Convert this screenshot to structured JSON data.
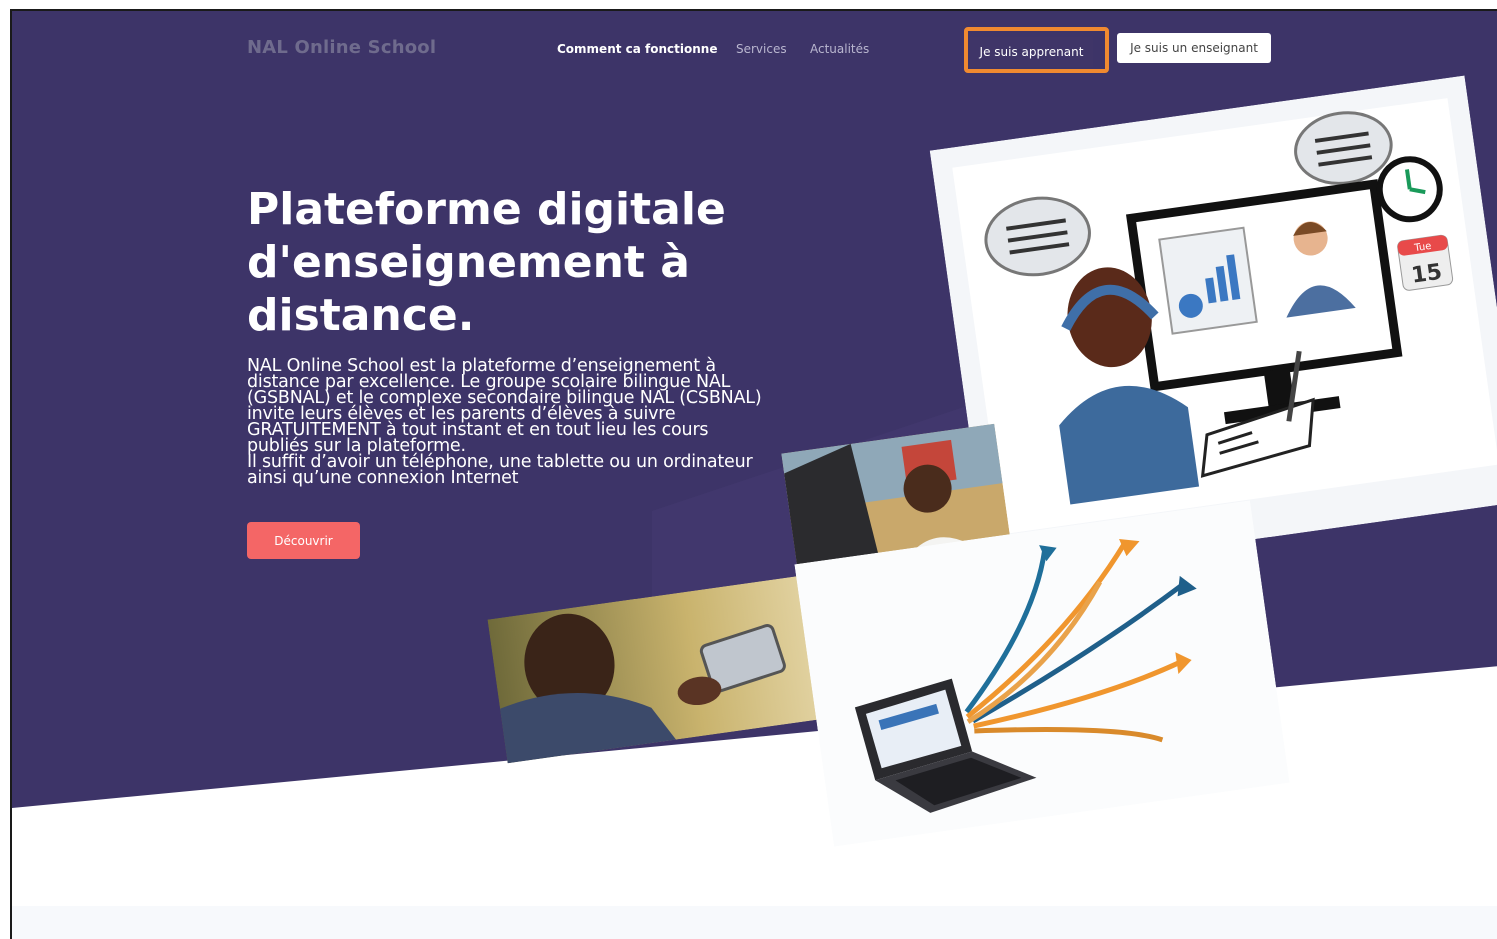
{
  "header": {
    "brand": "NAL Online School",
    "nav": [
      {
        "label": "Comment ca fonctionne",
        "active": true
      },
      {
        "label": "Services",
        "active": false
      },
      {
        "label": "Actualités",
        "active": false
      }
    ],
    "student_button": "Je suis apprenant",
    "teacher_button": "Je suis un enseignant"
  },
  "hero": {
    "title": "Plateforme digitale d'enseignement à distance.",
    "paragraph1": "NAL Online School est la plateforme d’enseignement à distance par excellence. Le groupe scolaire bilingue NAL (GSBNAL) et le complexe secondaire bilingue NAL (CSBNAL) invite leurs élèves et les parents d’élèves à suivre GRATUITEMENT à tout instant et en tout lieu les cours publiés sur la plateforme.",
    "paragraph2": "Il suffit d’avoir un téléphone, une tablette ou un ordinateur ainsi qu’une connexion Internet",
    "cta": "Découvrir"
  },
  "illustration": {
    "calendar_day": "Tue",
    "calendar_date": "15"
  },
  "colors": {
    "hero_bg": "#3d3468",
    "cta": "#f46666",
    "highlight": "#f08a30"
  }
}
